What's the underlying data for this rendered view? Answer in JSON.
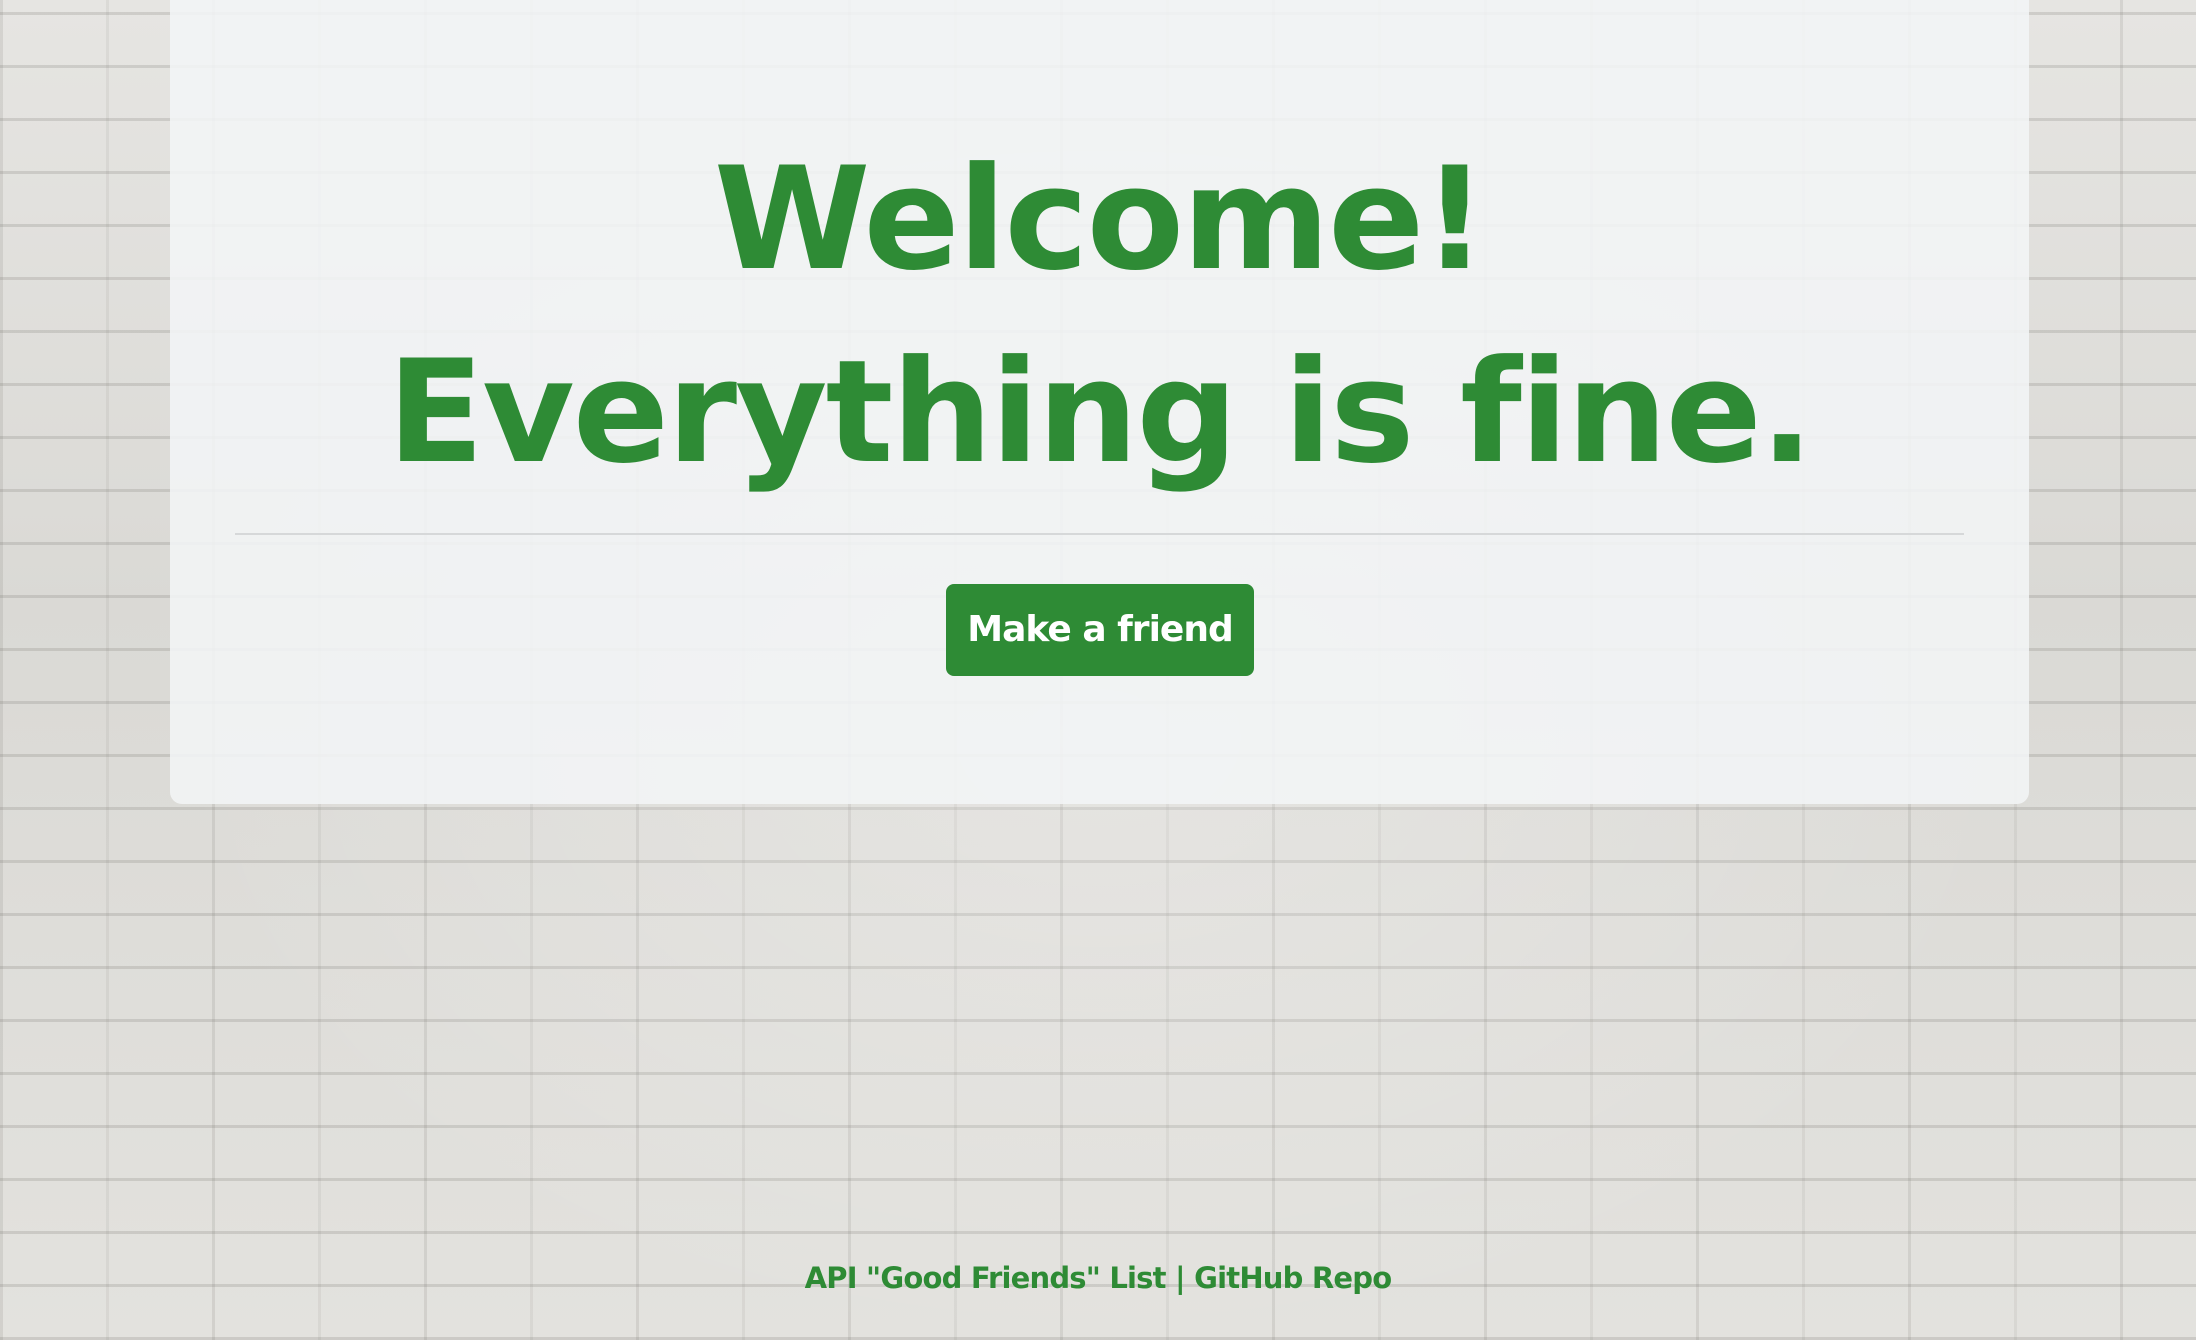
{
  "hero": {
    "line1": "Welcome!",
    "line2": "Everything is fine."
  },
  "actions": {
    "make_friend_label": "Make a friend"
  },
  "footer": {
    "api_link": "API \"Good Friends\" List",
    "separator": " | ",
    "github_link": "GitHub Repo"
  },
  "colors": {
    "accent": "#2e8b35",
    "panel": "#f3f5f6",
    "wall": "#dcdbd7"
  }
}
